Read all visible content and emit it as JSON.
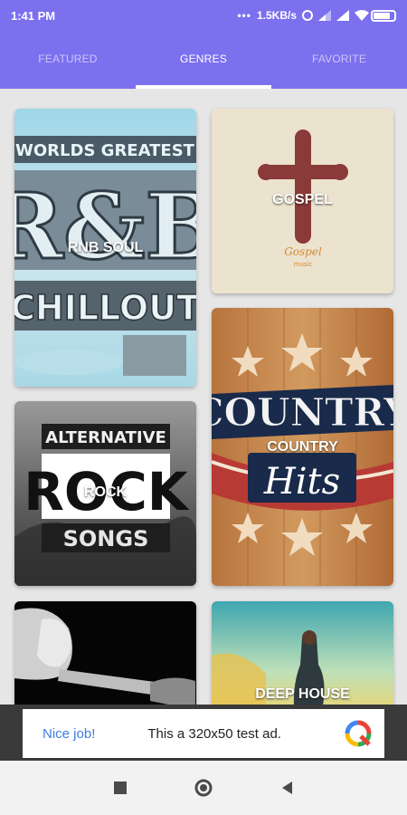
{
  "status": {
    "time": "1:41 PM",
    "network_speed": "1.5KB/s",
    "icons": [
      "more-dots-icon",
      "alarm-icon",
      "signal-icon",
      "signal-icon",
      "wifi-icon",
      "battery-icon"
    ]
  },
  "tabs": [
    {
      "label": "FEATURED",
      "active": false
    },
    {
      "label": "GENRES",
      "active": true
    },
    {
      "label": "FAVORITE",
      "active": false
    }
  ],
  "genres": [
    {
      "title": "RNB SOUL",
      "art_text": [
        "WORLDS GREATEST",
        "R&B",
        "CHILLOUT"
      ]
    },
    {
      "title": "GOSPEL",
      "art_text": [
        "Gospel",
        "music"
      ]
    },
    {
      "title": "ROCK",
      "art_text": [
        "ALTERNATIVE",
        "ROCK",
        "SONGS"
      ]
    },
    {
      "title": "COUNTRY",
      "art_text": [
        "COUNTRY",
        "Hits"
      ]
    },
    {
      "title": "",
      "art_text": []
    },
    {
      "title": "DEEP HOUSE",
      "art_text": []
    }
  ],
  "ad": {
    "cta": "Nice job!",
    "text": "This a 320x50 test ad."
  },
  "colors": {
    "primary": "#7b70ee",
    "background": "#e6e6e6",
    "ad_link": "#3b7fe0"
  }
}
